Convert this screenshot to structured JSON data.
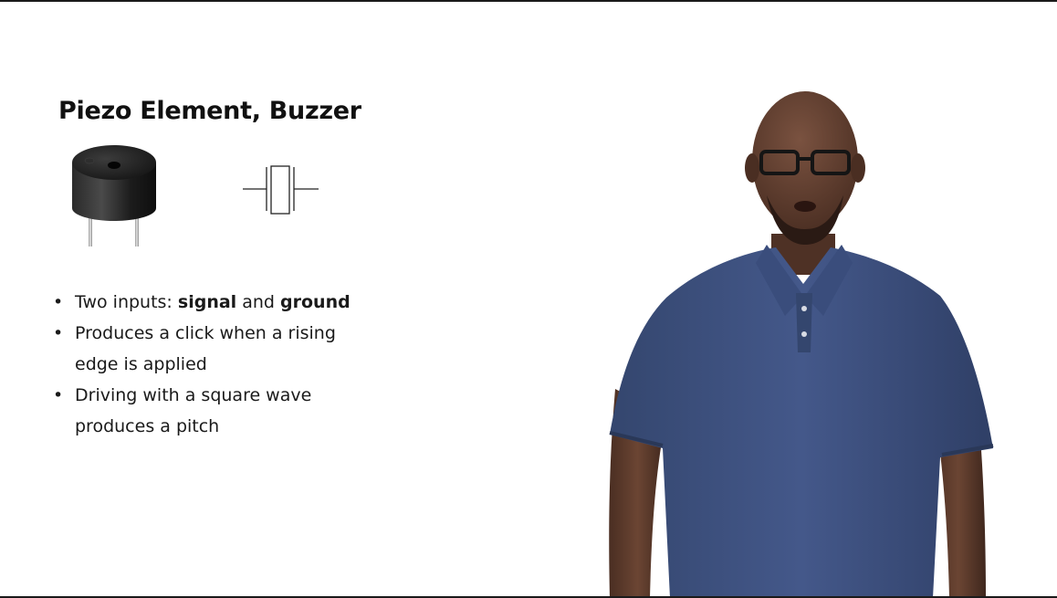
{
  "slide": {
    "title": "Piezo Element, Buzzer",
    "bullets": [
      {
        "dot": "•",
        "prefix": "Two inputs: ",
        "bold1": "signal",
        "middle": " and ",
        "bold2": "ground"
      },
      {
        "dot": "•",
        "line1": "Produces a click when a rising",
        "line2": "edge is applied"
      },
      {
        "dot": "•",
        "line1": "Driving with a square wave",
        "line2": "produces a pitch"
      }
    ]
  },
  "images": {
    "buzzer": "piezo-buzzer-photo",
    "symbol": "piezo-schematic-symbol",
    "presenter": "presenter-video"
  },
  "colors": {
    "background": "#ffffff",
    "text": "#1a1a1a",
    "shirt": "#3c4f7a",
    "skin": "#5a3a2a"
  }
}
